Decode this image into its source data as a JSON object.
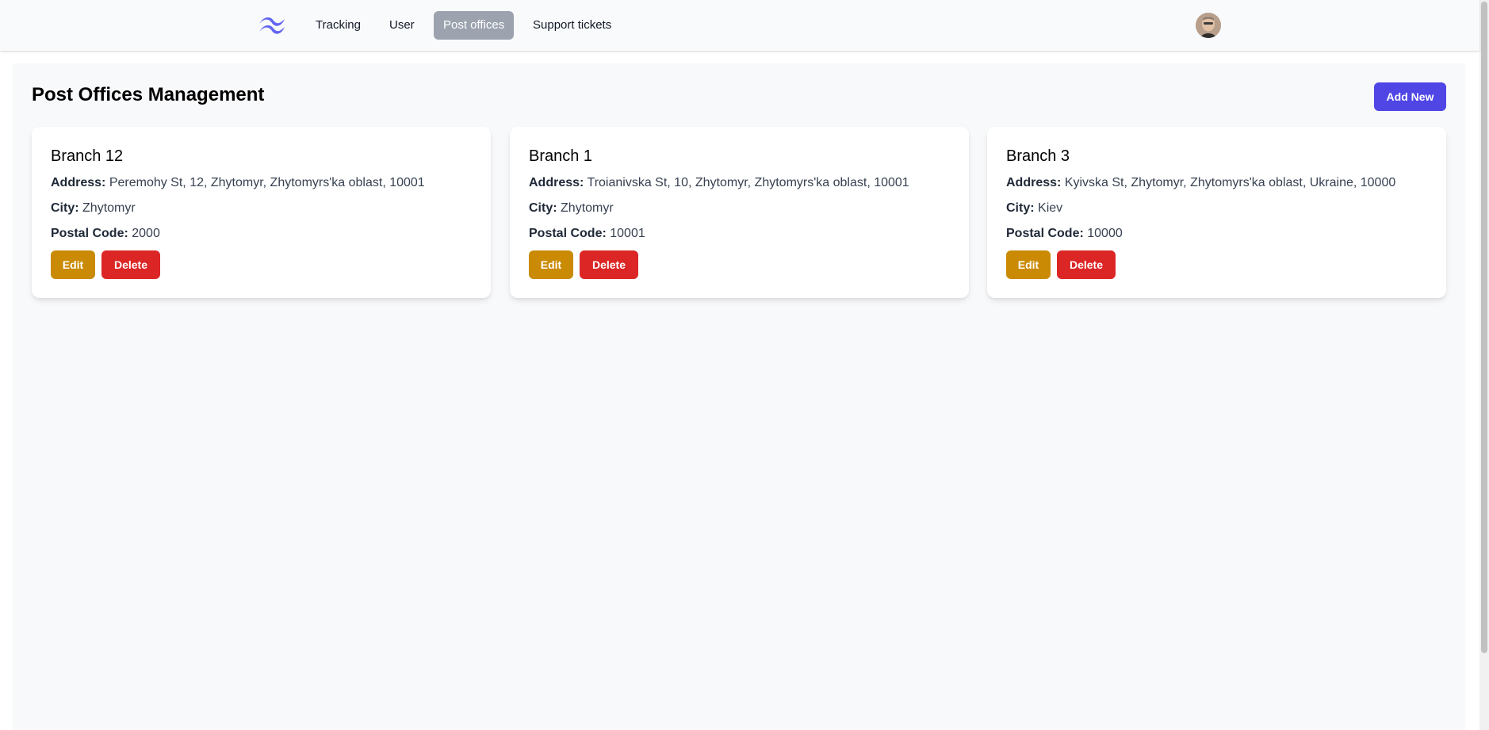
{
  "nav": {
    "logo": "tailwind-logo-icon",
    "items": [
      {
        "label": "Tracking",
        "active": false
      },
      {
        "label": "User",
        "active": false
      },
      {
        "label": "Post offices",
        "active": true
      },
      {
        "label": "Support tickets",
        "active": false
      }
    ],
    "avatar": "user-avatar"
  },
  "page": {
    "title": "Post Offices Management",
    "add_button": "Add New"
  },
  "labels": {
    "address": "Address:",
    "city": "City:",
    "postal_code": "Postal Code:",
    "edit": "Edit",
    "delete": "Delete"
  },
  "offices": [
    {
      "name": "Branch 12",
      "address": "Peremohy St, 12, Zhytomyr, Zhytomyrs'ka oblast, 10001",
      "city": "Zhytomyr",
      "postal_code": "2000"
    },
    {
      "name": "Branch 1",
      "address": "Troianivska St, 10, Zhytomyr, Zhytomyrs'ka oblast, 10001",
      "city": "Zhytomyr",
      "postal_code": "10001"
    },
    {
      "name": "Branch 3",
      "address": "Kyivska St, Zhytomyr, Zhytomyrs'ka oblast, Ukraine, 10000",
      "city": "Kiev",
      "postal_code": "10000"
    }
  ],
  "colors": {
    "accent": "#4f46e5",
    "edit": "#ca8a04",
    "delete": "#dc2626",
    "nav_active": "#9ca3af"
  }
}
